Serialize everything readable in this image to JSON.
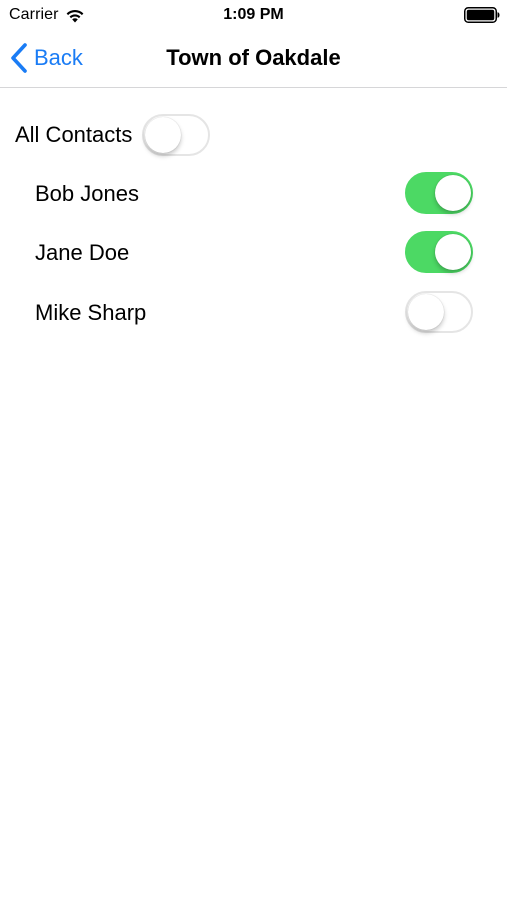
{
  "status_bar": {
    "carrier": "Carrier",
    "time": "1:09 PM",
    "wifi_icon": "wifi-icon",
    "battery_icon": "battery-full-icon"
  },
  "nav": {
    "back_label": "Back",
    "back_icon": "chevron-left-icon",
    "title": "Town of Oakdale"
  },
  "all_contacts": {
    "label": "All Contacts",
    "on": false
  },
  "contacts": [
    {
      "name": "Bob Jones",
      "on": true
    },
    {
      "name": "Jane Doe",
      "on": true
    },
    {
      "name": "Mike Sharp",
      "on": false
    }
  ],
  "colors": {
    "accent": "#1a7cf5",
    "toggle_on": "#4cd964",
    "toggle_off_border": "#e5e5e5",
    "separator": "#d6d6d8"
  }
}
